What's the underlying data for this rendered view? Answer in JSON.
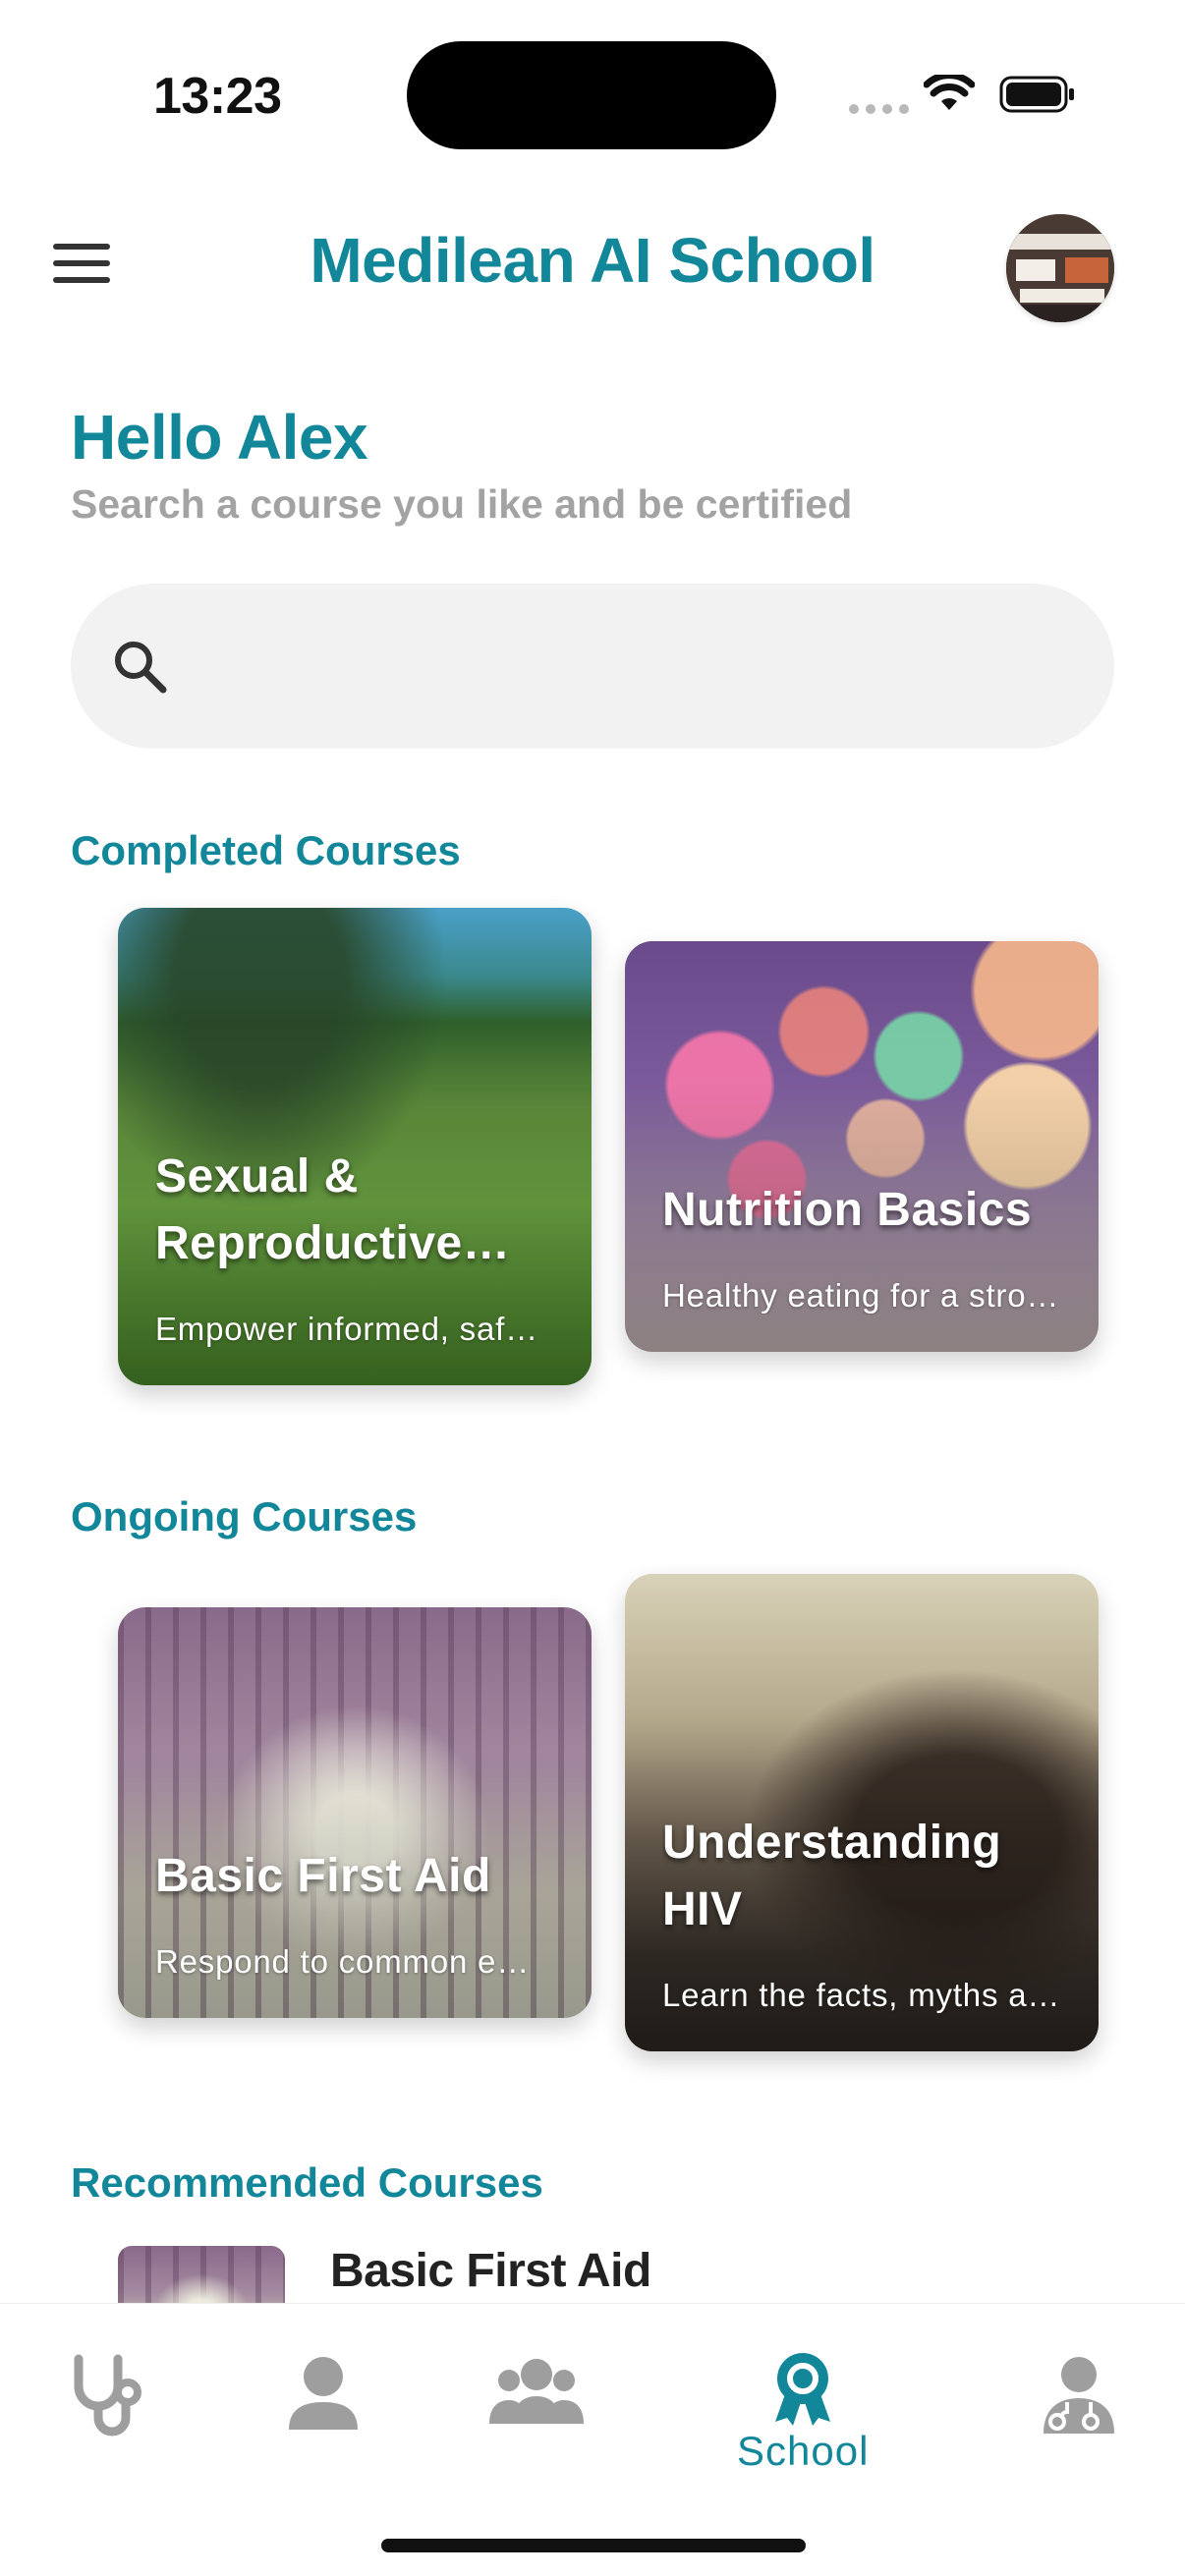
{
  "status_bar": {
    "time": "13:23"
  },
  "header": {
    "title": "Medilean AI School",
    "menu_icon": "menu-icon",
    "avatar": "user-avatar"
  },
  "greeting": {
    "title": "Hello Alex",
    "subtitle": "Search a course you like and be certified"
  },
  "search": {
    "placeholder": "",
    "value": "",
    "icon": "search-icon"
  },
  "sections": {
    "completed": {
      "title": "Completed Courses",
      "courses": [
        {
          "title": "Sexual & Reproductive Health",
          "description": "Empower informed, safe and healthy choices"
        },
        {
          "title": "Nutrition Basics",
          "description": "Healthy eating for a stronger life"
        }
      ]
    },
    "ongoing": {
      "title": "Ongoing Courses",
      "courses": [
        {
          "title": "Basic First Aid",
          "description": "Respond to common emergencies"
        },
        {
          "title": "Understanding HIV",
          "description": "Learn the facts, myths and prevention"
        }
      ]
    },
    "recommended": {
      "title": "Recommended Courses",
      "courses": [
        {
          "title": "Basic First Aid"
        }
      ]
    }
  },
  "bottom_nav": {
    "items": [
      {
        "icon": "stethoscope-icon",
        "label": "",
        "active": false
      },
      {
        "icon": "person-icon",
        "label": "",
        "active": false
      },
      {
        "icon": "group-icon",
        "label": "",
        "active": false
      },
      {
        "icon": "award-icon",
        "label": "School",
        "active": true
      },
      {
        "icon": "doctor-icon",
        "label": "",
        "active": false
      }
    ]
  },
  "colors": {
    "accent": "#12879a",
    "muted_text": "#a3a3a3",
    "inactive_icon": "#9e9e9e",
    "search_bg": "#f2f2f2"
  }
}
